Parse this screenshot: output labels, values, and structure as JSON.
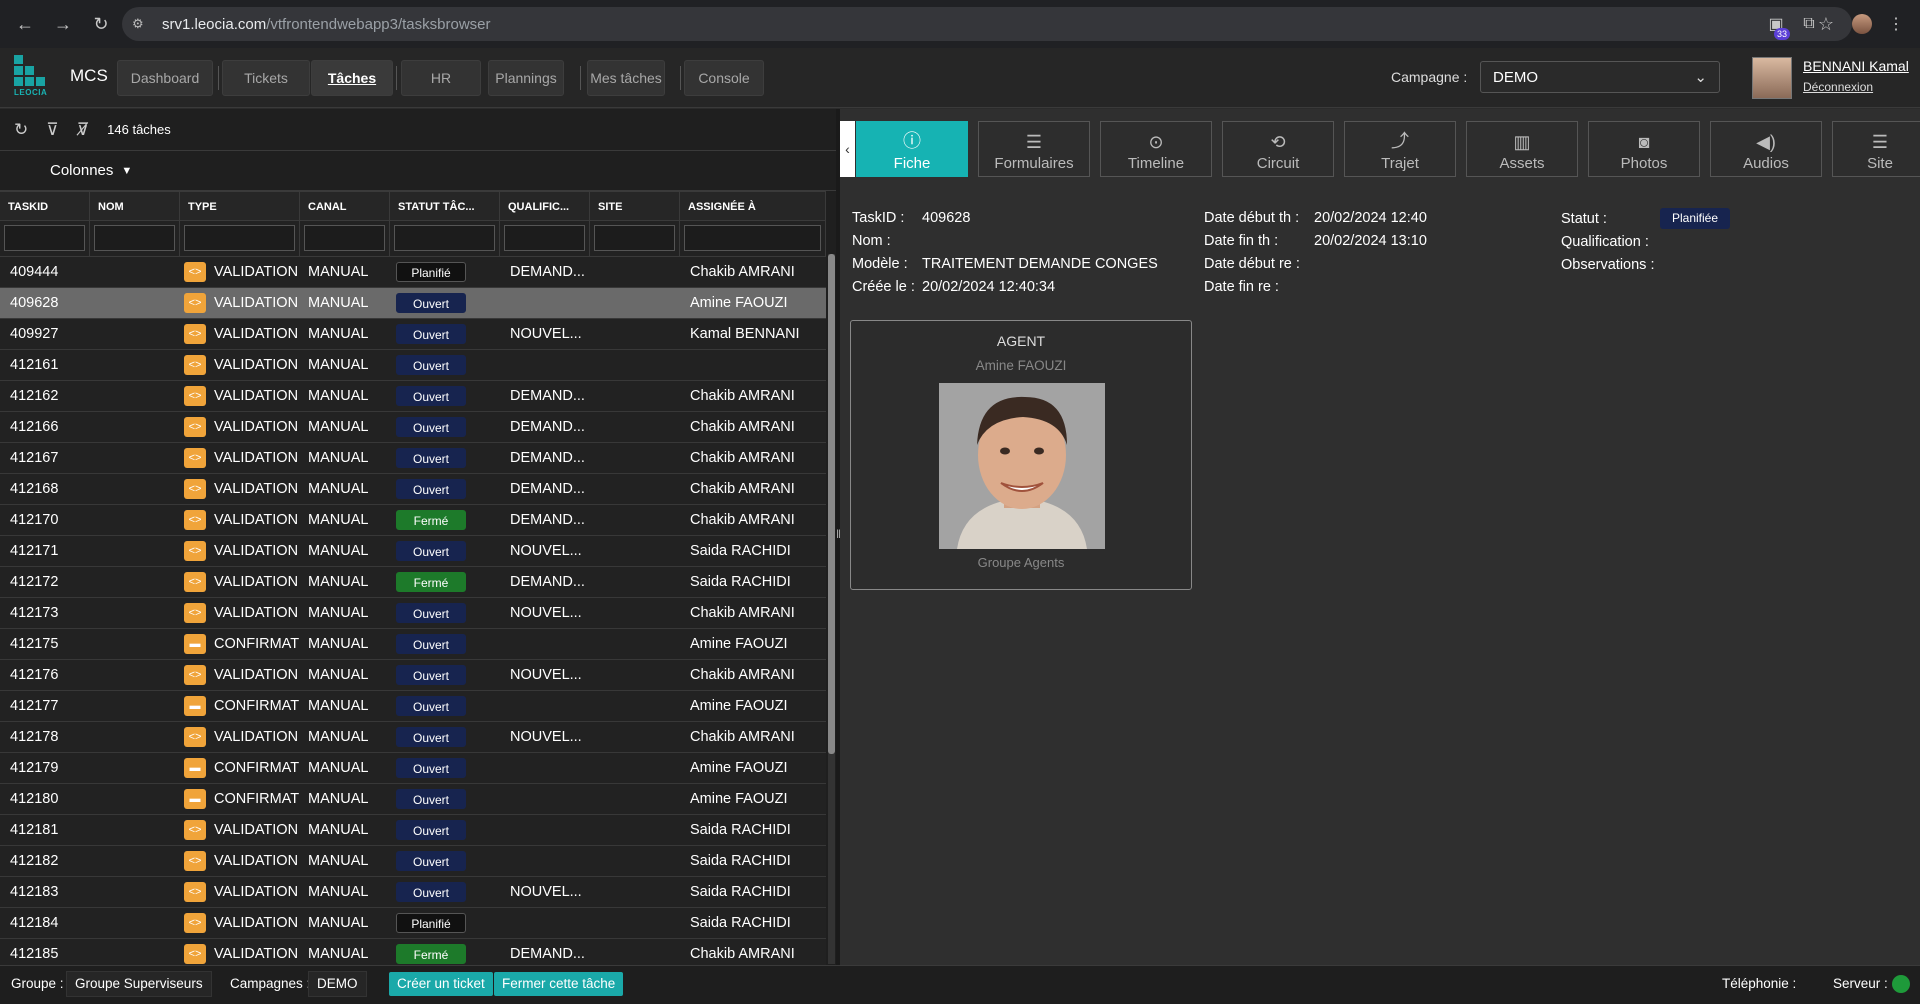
{
  "browser": {
    "url_host": "srv1.leocia.com",
    "url_path": "/vtfrontendwebapp3/tasksbrowser",
    "ext_badge": "33"
  },
  "app": {
    "logo_text": "LEOCIA",
    "name": "MCS",
    "menu": [
      "Dashboard",
      "Tickets",
      "Tâches",
      "HR",
      "Plannings",
      "Mes tâches",
      "Console"
    ],
    "active_menu": "Tâches",
    "campaign_label": "Campagne :",
    "campaign_value": "DEMO",
    "user_name": "BENNANI Kamal",
    "logout": "Déconnexion"
  },
  "list": {
    "count": "146 tâches",
    "columns_button": "Colonnes",
    "headers": [
      "TASKID",
      "NOM",
      "TYPE",
      "CANAL",
      "STATUT TÂC...",
      "QUALIFIC...",
      "SITE",
      "ASSIGNÉE À"
    ],
    "rows": [
      {
        "id": "409444",
        "type": "VALIDATION",
        "canal": "MANUAL",
        "statut": "Planifié",
        "qualif": "DEMAND...",
        "assignee": "Chakib AMRANI",
        "icon": "code"
      },
      {
        "id": "409628",
        "type": "VALIDATION",
        "canal": "MANUAL",
        "statut": "Ouvert",
        "qualif": "",
        "assignee": "Amine FAOUZI",
        "icon": "code",
        "selected": true
      },
      {
        "id": "409927",
        "type": "VALIDATION",
        "canal": "MANUAL",
        "statut": "Ouvert",
        "qualif": "NOUVEL...",
        "assignee": "Kamal BENNANI",
        "icon": "code"
      },
      {
        "id": "412161",
        "type": "VALIDATION",
        "canal": "MANUAL",
        "statut": "Ouvert",
        "qualif": "",
        "assignee": "",
        "icon": "code"
      },
      {
        "id": "412162",
        "type": "VALIDATION",
        "canal": "MANUAL",
        "statut": "Ouvert",
        "qualif": "DEMAND...",
        "assignee": "Chakib AMRANI",
        "icon": "code"
      },
      {
        "id": "412166",
        "type": "VALIDATION",
        "canal": "MANUAL",
        "statut": "Ouvert",
        "qualif": "DEMAND...",
        "assignee": "Chakib AMRANI",
        "icon": "code"
      },
      {
        "id": "412167",
        "type": "VALIDATION",
        "canal": "MANUAL",
        "statut": "Ouvert",
        "qualif": "DEMAND...",
        "assignee": "Chakib AMRANI",
        "icon": "code"
      },
      {
        "id": "412168",
        "type": "VALIDATION",
        "canal": "MANUAL",
        "statut": "Ouvert",
        "qualif": "DEMAND...",
        "assignee": "Chakib AMRANI",
        "icon": "code"
      },
      {
        "id": "412170",
        "type": "VALIDATION",
        "canal": "MANUAL",
        "statut": "Fermé",
        "qualif": "DEMAND...",
        "assignee": "Chakib AMRANI",
        "icon": "code"
      },
      {
        "id": "412171",
        "type": "VALIDATION",
        "canal": "MANUAL",
        "statut": "Ouvert",
        "qualif": "NOUVEL...",
        "assignee": "Saida RACHIDI",
        "icon": "code"
      },
      {
        "id": "412172",
        "type": "VALIDATION",
        "canal": "MANUAL",
        "statut": "Fermé",
        "qualif": "DEMAND...",
        "assignee": "Saida RACHIDI",
        "icon": "code"
      },
      {
        "id": "412173",
        "type": "VALIDATION",
        "canal": "MANUAL",
        "statut": "Ouvert",
        "qualif": "NOUVEL...",
        "assignee": "Chakib AMRANI",
        "icon": "code"
      },
      {
        "id": "412175",
        "type": "CONFIRMAT",
        "canal": "MANUAL",
        "statut": "Ouvert",
        "qualif": "",
        "assignee": "Amine FAOUZI",
        "icon": "chat"
      },
      {
        "id": "412176",
        "type": "VALIDATION",
        "canal": "MANUAL",
        "statut": "Ouvert",
        "qualif": "NOUVEL...",
        "assignee": "Chakib AMRANI",
        "icon": "code"
      },
      {
        "id": "412177",
        "type": "CONFIRMAT",
        "canal": "MANUAL",
        "statut": "Ouvert",
        "qualif": "",
        "assignee": "Amine FAOUZI",
        "icon": "chat"
      },
      {
        "id": "412178",
        "type": "VALIDATION",
        "canal": "MANUAL",
        "statut": "Ouvert",
        "qualif": "NOUVEL...",
        "assignee": "Chakib AMRANI",
        "icon": "code"
      },
      {
        "id": "412179",
        "type": "CONFIRMAT",
        "canal": "MANUAL",
        "statut": "Ouvert",
        "qualif": "",
        "assignee": "Amine FAOUZI",
        "icon": "chat"
      },
      {
        "id": "412180",
        "type": "CONFIRMAT",
        "canal": "MANUAL",
        "statut": "Ouvert",
        "qualif": "",
        "assignee": "Amine FAOUZI",
        "icon": "chat"
      },
      {
        "id": "412181",
        "type": "VALIDATION",
        "canal": "MANUAL",
        "statut": "Ouvert",
        "qualif": "",
        "assignee": "Saida RACHIDI",
        "icon": "code"
      },
      {
        "id": "412182",
        "type": "VALIDATION",
        "canal": "MANUAL",
        "statut": "Ouvert",
        "qualif": "",
        "assignee": "Saida RACHIDI",
        "icon": "code"
      },
      {
        "id": "412183",
        "type": "VALIDATION",
        "canal": "MANUAL",
        "statut": "Ouvert",
        "qualif": "NOUVEL...",
        "assignee": "Saida RACHIDI",
        "icon": "code"
      },
      {
        "id": "412184",
        "type": "VALIDATION",
        "canal": "MANUAL",
        "statut": "Planifié",
        "qualif": "",
        "assignee": "Saida RACHIDI",
        "icon": "code"
      },
      {
        "id": "412185",
        "type": "VALIDATION",
        "canal": "MANUAL",
        "statut": "Fermé",
        "qualif": "DEMAND...",
        "assignee": "Chakib AMRANI",
        "icon": "code"
      }
    ]
  },
  "tabs": [
    {
      "label": "Fiche",
      "icon": "info-icon",
      "glyph": "ⓘ",
      "active": true
    },
    {
      "label": "Formulaires",
      "icon": "list-icon",
      "glyph": "☰"
    },
    {
      "label": "Timeline",
      "icon": "timeline-icon",
      "glyph": "⊙"
    },
    {
      "label": "Circuit",
      "icon": "circuit-icon",
      "glyph": "⟲"
    },
    {
      "label": "Trajet",
      "icon": "route-icon",
      "glyph": "⤴"
    },
    {
      "label": "Assets",
      "icon": "barcode-icon",
      "glyph": "▥"
    },
    {
      "label": "Photos",
      "icon": "camera-icon",
      "glyph": "◙"
    },
    {
      "label": "Audios",
      "icon": "speaker-icon",
      "glyph": "◀)"
    },
    {
      "label": "Site",
      "icon": "list-icon",
      "glyph": "☰"
    }
  ],
  "fiche": {
    "taskid_label": "TaskID :",
    "taskid": "409628",
    "nom_label": "Nom :",
    "modele_label": "Modèle :",
    "modele": "TRAITEMENT DEMANDE CONGES",
    "creee_label": "Créée le :",
    "creee": "20/02/2024 12:40:34",
    "debut_th_label": "Date début th :",
    "debut_th": "20/02/2024 12:40",
    "fin_th_label": "Date fin th :",
    "fin_th": "20/02/2024 13:10",
    "debut_re_label": "Date début re :",
    "fin_re_label": "Date fin re :",
    "statut_label": "Statut :",
    "statut": "Planifiée",
    "qualification_label": "Qualification :",
    "observations_label": "Observations :",
    "agent_title": "AGENT",
    "agent_name": "Amine FAOUZI",
    "agent_group": "Groupe Agents"
  },
  "statusbar": {
    "groupe_label": "Groupe :",
    "groupe": "Groupe Superviseurs",
    "campagnes_label": "Campagnes :",
    "campagnes": "DEMO",
    "create_ticket": "Créer un ticket",
    "close_task": "Fermer cette tâche",
    "telephonie": "Téléphonie :",
    "serveur": "Serveur :"
  }
}
